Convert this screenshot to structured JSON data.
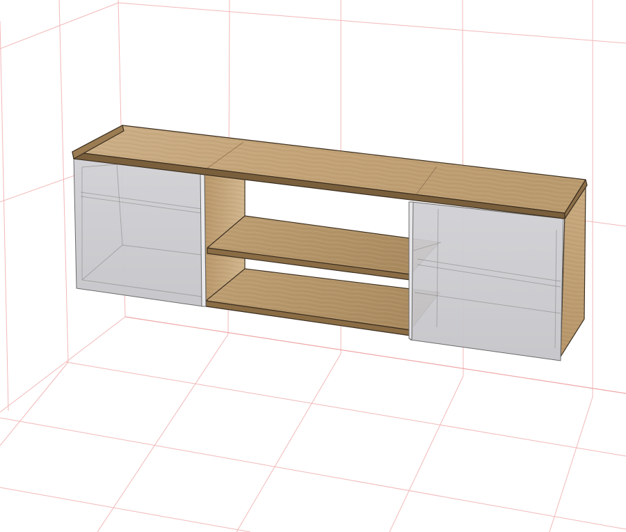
{
  "colors": {
    "background": "#ffffff",
    "grid": "#f2b8b8",
    "wood_light": "#c7a77c",
    "wood_mid": "#b8976a",
    "wood_dark": "#9c7c52",
    "door_glass": "#c9c9cd",
    "door_edge": "#6a6a6a",
    "outline": "#3a2e20"
  },
  "icons": {
    "scene": "3d-furniture-model"
  }
}
